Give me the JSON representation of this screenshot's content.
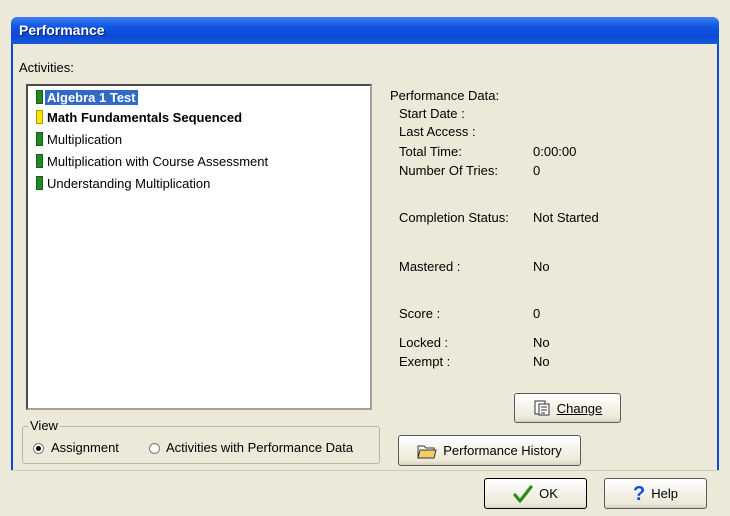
{
  "window": {
    "title": "Performance"
  },
  "activities": {
    "label": "Activities:",
    "items": [
      {
        "label": "Algebra 1 Test",
        "marker_color": "#1f8a1f",
        "selected": true,
        "bold": true
      },
      {
        "label": "Math Fundamentals Sequenced",
        "marker_color": "#f5e600",
        "selected": false,
        "bold": true
      },
      {
        "label": "Multiplication",
        "marker_color": "#1f8a1f",
        "selected": false,
        "bold": false
      },
      {
        "label": "Multiplication with Course Assessment",
        "marker_color": "#1f8a1f",
        "selected": false,
        "bold": false
      },
      {
        "label": "Understanding Multiplication",
        "marker_color": "#1f8a1f",
        "selected": false,
        "bold": false
      }
    ]
  },
  "view": {
    "label": "View",
    "options": [
      {
        "label": "Assignment",
        "selected": true
      },
      {
        "label": "Activities with Performance Data",
        "selected": false
      }
    ]
  },
  "performance": {
    "header": "Performance Data:",
    "start_date_label": "Start Date :",
    "start_date_value": "",
    "last_access_label": "Last Access :",
    "last_access_value": "",
    "total_time_label": "Total Time:",
    "total_time_value": "0:00:00",
    "tries_label": "Number Of Tries:",
    "tries_value": "0",
    "completion_label": "Completion Status:",
    "completion_value": "Not Started",
    "mastered_label": "Mastered :",
    "mastered_value": "No",
    "score_label": "Score :",
    "score_value": "0",
    "locked_label": "Locked :",
    "locked_value": "No",
    "exempt_label": "Exempt :",
    "exempt_value": "No"
  },
  "buttons": {
    "change": "Change",
    "history": "Performance History",
    "ok": "OK",
    "help": "Help"
  },
  "colors": {
    "titlebar": "#0a49d6",
    "selection": "#316ac5"
  }
}
